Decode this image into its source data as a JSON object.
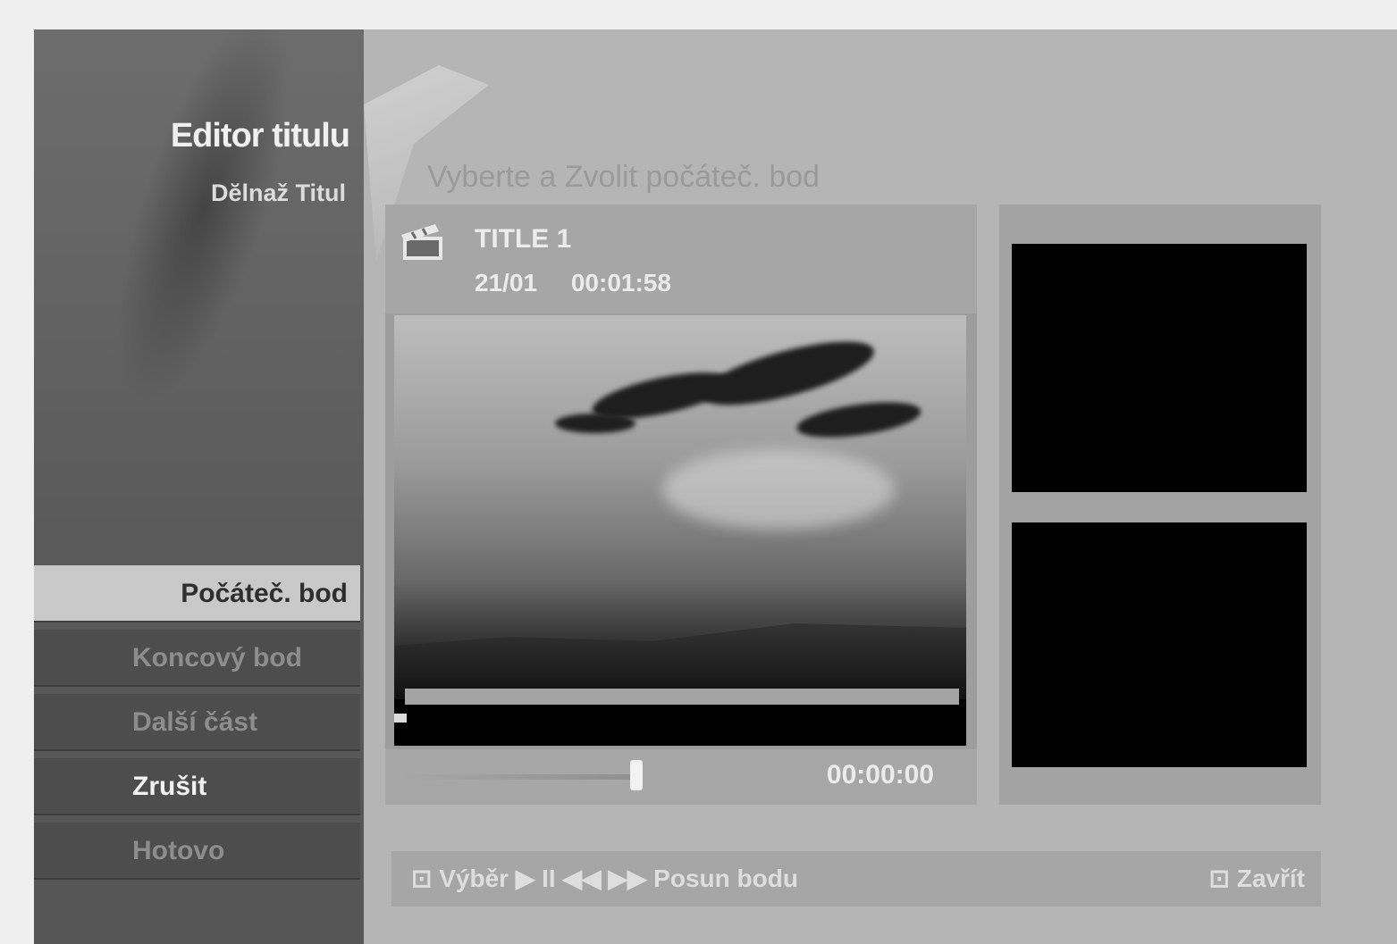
{
  "sidebar": {
    "title": "Editor titulu",
    "subtitle": "Dĕlnaž Titul",
    "menu": [
      {
        "label": "Počáteč. bod",
        "state": "selected"
      },
      {
        "label": "Koncový bod",
        "state": "disabled"
      },
      {
        "label": "Další část",
        "state": "disabled"
      },
      {
        "label": "Zrušit",
        "state": "active"
      },
      {
        "label": "Hotovo",
        "state": "disabled"
      }
    ]
  },
  "heading": "Vyberte a Zvolit počáteč. bod",
  "player": {
    "title": "TITLE 1",
    "date": "21/01",
    "duration": "00:01:58",
    "time": "00:00:00",
    "icon": "clapperboard-icon"
  },
  "hint": {
    "left": "⊡ Výběr  ▶ II ◀◀ ▶▶ Posun bodu",
    "right": "⊡ Zavřít"
  },
  "colors": {
    "sidebar": "#5a5a5a",
    "selected": "#c9c9c9",
    "panel": "#a6a6a6",
    "background": "#b5b5b5"
  }
}
